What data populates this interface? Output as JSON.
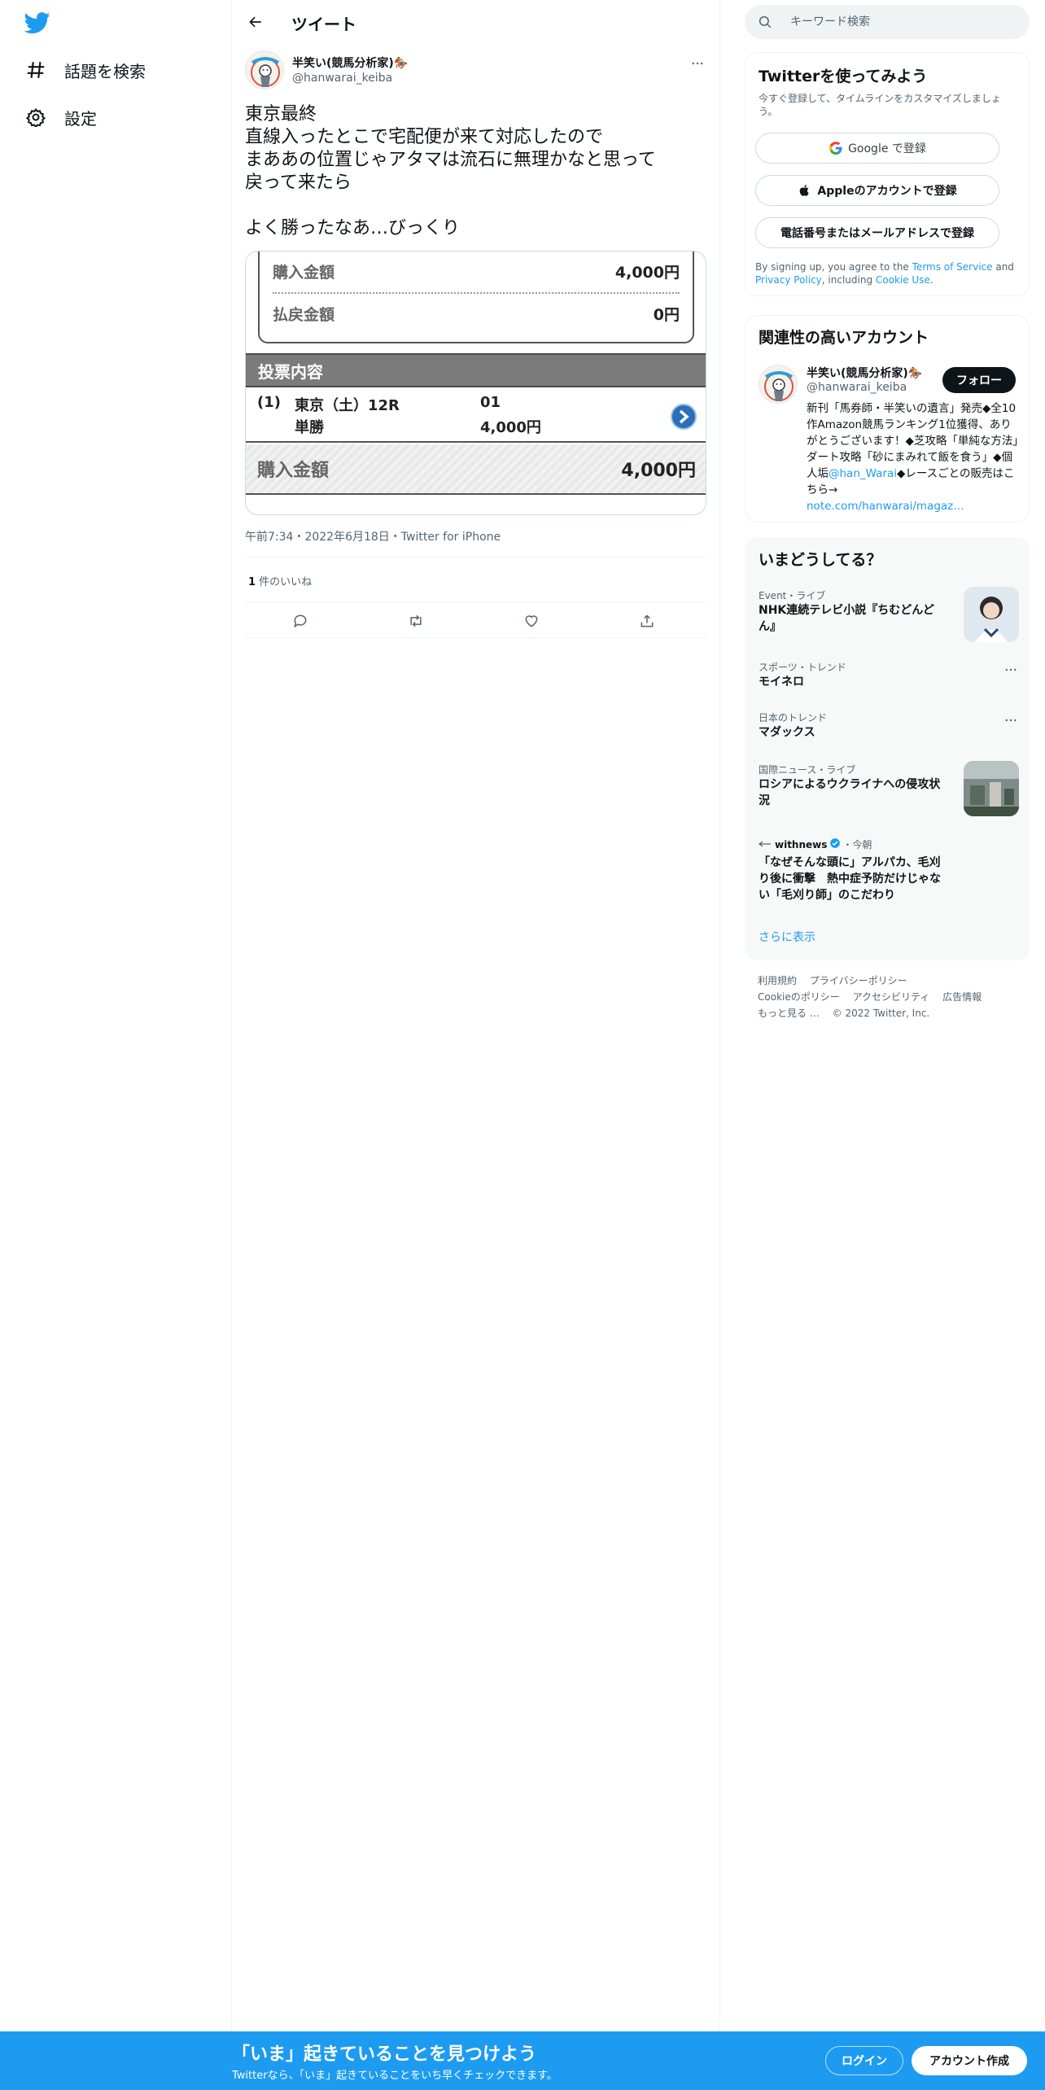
{
  "sidebar": {
    "items": [
      {
        "label": "話題を検索",
        "icon": "hashtag-icon"
      },
      {
        "label": "設定",
        "icon": "gear-icon"
      }
    ]
  },
  "header": {
    "title": "ツイート"
  },
  "tweet": {
    "author_name": "半笑い(競馬分析家)🏇",
    "author_handle": "@hanwarai_keiba",
    "text_lines": [
      "東京最終",
      "直線入ったとこで宅配便が来て対応したので",
      "まああの位置じゃアタマは流石に無理かなと思って",
      "戻って来たら",
      "",
      "よく勝ったなあ…びっくり"
    ],
    "meta": "午前7:34・2022年6月18日・Twitter for iPhone",
    "likes_count": "1",
    "likes_label": " 件のいいね"
  },
  "media": {
    "purchase_label": "購入金額",
    "purchase_value": "4,000円",
    "refund_label": "払戻金額",
    "refund_value": "0円",
    "vote_header": "投票内容",
    "vote_num": "(1)",
    "vote_race": "東京（土）12R",
    "vote_type": "単勝",
    "vote_horse": "01",
    "vote_amount": "4,000円",
    "total_label": "購入金額",
    "total_value": "4,000円"
  },
  "search": {
    "placeholder": "キーワード検索"
  },
  "signup": {
    "title": "Twitterを使ってみよう",
    "desc": "今すぐ登録して、タイムラインをカスタマイズしましょう。",
    "google_label": "Google で登録",
    "apple_label": "Appleのアカウントで登録",
    "phone_label": "電話番号またはメールアドレスで登録",
    "terms_pre": "By signing up, you agree to the ",
    "terms_link": "Terms of Service",
    "terms_mid": " and ",
    "privacy_link": "Privacy Policy",
    "terms_mid2": ", including ",
    "cookie_link": "Cookie Use",
    "terms_end": "."
  },
  "related": {
    "title": "関連性の高いアカウント",
    "name": "半笑い(競馬分析家)🏇",
    "handle": "@hanwarai_keiba",
    "follow_label": "フォロー",
    "bio_text": "新刊「馬券師・半笑いの遺言」発売◆全10作Amazon競馬ランキング1位獲得、ありがとうございます！◆芝攻略「単純な方法」ダート攻略「砂にまみれて飯を食う」◆個人垢",
    "bio_mention": "@han_Warai",
    "bio_text2": "◆レースごとの販売はこちら→",
    "bio_link": "note.com/hanwarai/magaz…"
  },
  "trends": {
    "title": "いまどうしてる？",
    "items": [
      {
        "meta": "Event・ライブ",
        "title": "NHK連続テレビ小説『ちむどんどん』"
      },
      {
        "meta": "スポーツ・トレンド",
        "title": "モイネロ"
      },
      {
        "meta": "日本のトレンド",
        "title": "マダックス"
      },
      {
        "meta": "国際ニュース・ライブ",
        "title": "ロシアによるウクライナへの侵攻状況"
      },
      {
        "meta": "・今朝",
        "source": "withnews",
        "title": "「なぜそんな頭に」アルパカ、毛刈り後に衝撃　熱中症予防だけじゃない「毛刈り師」のこだわり"
      }
    ],
    "show_more": "さらに表示"
  },
  "footer": {
    "links": [
      "利用規約",
      "プライバシーポリシー",
      "Cookieのポリシー",
      "アクセシビリティ",
      "広告情報",
      "もっと見る …",
      "© 2022 Twitter, Inc."
    ]
  },
  "banner": {
    "title": "「いま」起きていることを見つけよう",
    "subtitle": "Twitterなら、「いま」起きていることをいち早くチェックできます。",
    "login_label": "ログイン",
    "signup_label": "アカウント作成"
  },
  "colors": {
    "accent": "#1d9bf0",
    "text": "#0f1419",
    "muted": "#536471",
    "banner": "#1d9bf0"
  }
}
